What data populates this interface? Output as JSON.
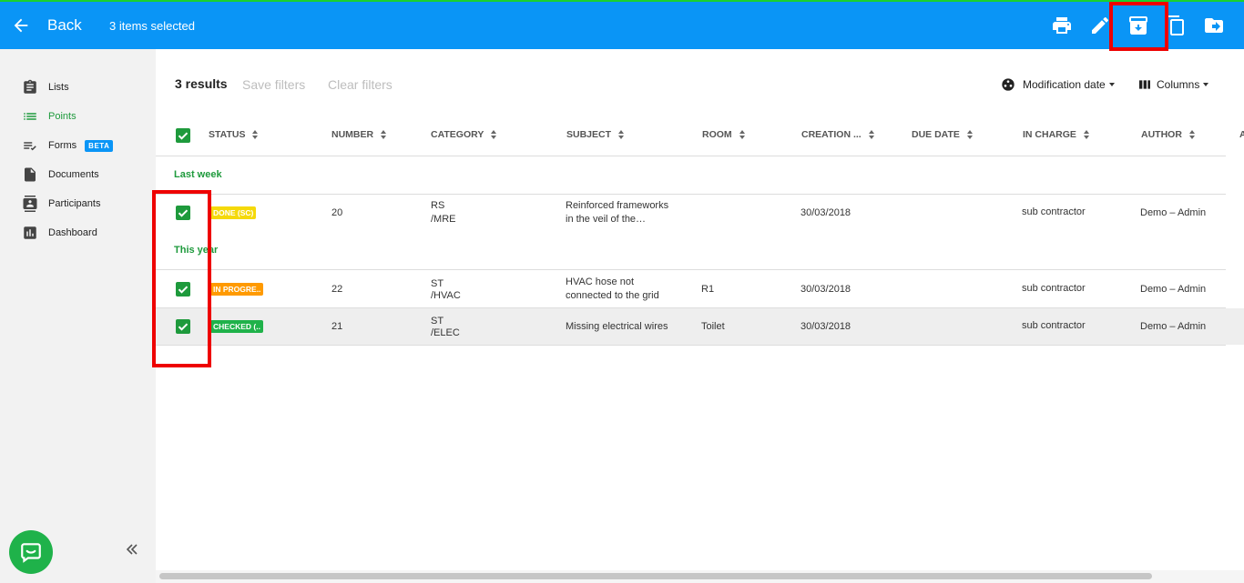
{
  "topbar": {
    "back_label": "Back",
    "selected_text": "3 items selected",
    "icons": [
      "print-icon",
      "edit-icon",
      "archive-icon",
      "copy-icon",
      "move-icon"
    ],
    "color": "#0a95f6"
  },
  "sidebar": {
    "items": [
      {
        "label": "Lists",
        "icon": "clipboard-icon"
      },
      {
        "label": "Points",
        "icon": "list-icon",
        "active": true
      },
      {
        "label": "Forms",
        "icon": "checklist-icon",
        "badge": "BETA"
      },
      {
        "label": "Documents",
        "icon": "document-icon"
      },
      {
        "label": "Participants",
        "icon": "contacts-icon"
      },
      {
        "label": "Dashboard",
        "icon": "chart-icon"
      }
    ]
  },
  "toolbar": {
    "results": "3 results",
    "save_filters": "Save filters",
    "clear_filters": "Clear filters",
    "sort_label": "Modification date",
    "columns_label": "Columns"
  },
  "table": {
    "headers": [
      "STATUS",
      "NUMBER",
      "CATEGORY",
      "SUBJECT",
      "ROOM",
      "CREATION ...",
      "DUE DATE",
      "IN CHARGE",
      "AUTHOR",
      "A"
    ],
    "groups": [
      {
        "label": "Last week",
        "rows": [
          {
            "status": "DONE (SC)",
            "status_color": "#f5d90a",
            "number": "20",
            "category_1": "RS",
            "category_2": "/MRE",
            "subject_1": "Reinforced frameworks",
            "subject_2": "in the veil of the…",
            "room": "",
            "creation": "30/03/2018",
            "due": "",
            "in_charge": "sub contractor",
            "author": "Demo – Admin"
          }
        ]
      },
      {
        "label": "This year",
        "rows": [
          {
            "status": "IN PROGRE..",
            "status_color": "#ff9a00",
            "number": "22",
            "category_1": "ST",
            "category_2": "/HVAC",
            "subject_1": "HVAC hose not",
            "subject_2": "connected to the grid",
            "room": "R1",
            "creation": "30/03/2018",
            "due": "",
            "in_charge": "sub contractor",
            "author": "Demo – Admin"
          },
          {
            "status": "CHECKED (..",
            "status_color": "#1fb24a",
            "number": "21",
            "category_1": "ST",
            "category_2": "/ELEC",
            "subject_1": "Missing electrical wires",
            "subject_2": "",
            "room": "Toilet",
            "creation": "30/03/2018",
            "due": "",
            "in_charge": "sub contractor",
            "author": "Demo – Admin"
          }
        ]
      }
    ]
  }
}
